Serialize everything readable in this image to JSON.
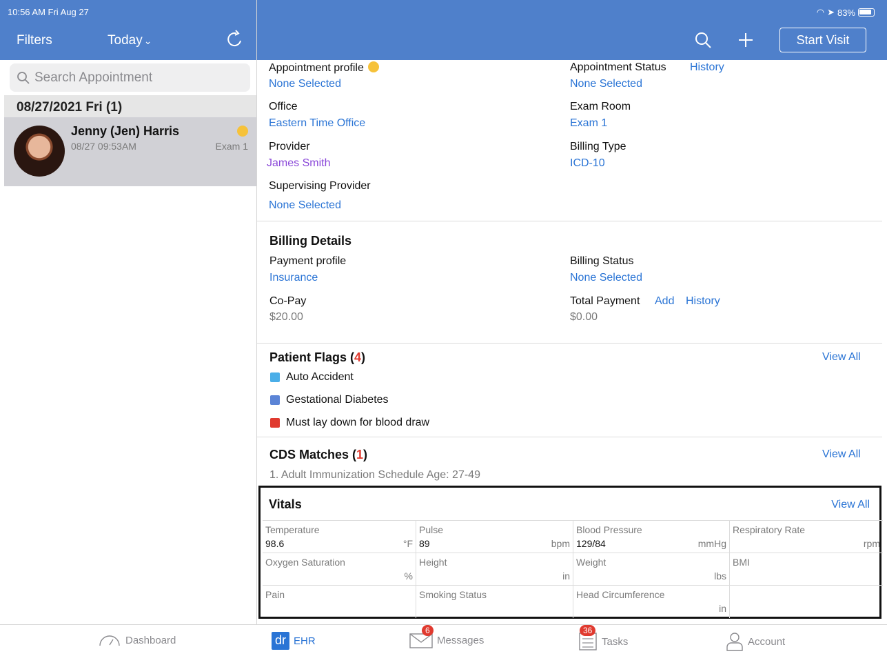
{
  "status_bar": {
    "time": "10:56 AM  Fri Aug 27",
    "battery": "83%"
  },
  "left_nav": {
    "filters": "Filters",
    "today": "Today",
    "today_chevron": "⌄"
  },
  "right_nav": {
    "start_visit": "Start Visit"
  },
  "search": {
    "placeholder": "Search Appointment"
  },
  "date_header": "08/27/2021 Fri (1)",
  "appointment": {
    "name": "Jenny (Jen) Harris",
    "time": "08/27 09:53AM",
    "room": "Exam 1"
  },
  "details": {
    "appointment_profile_label": "Appointment profile",
    "appointment_profile_value": "None Selected",
    "appointment_status_label": "Appointment Status",
    "appointment_status_history": "History",
    "appointment_status_value": "None Selected",
    "office_label": "Office",
    "office_value": "Eastern Time Office",
    "exam_room_label": "Exam Room",
    "exam_room_value": "Exam 1",
    "provider_label": "Provider",
    "provider_value": "James Smith",
    "billing_type_label": "Billing Type",
    "billing_type_value": "ICD-10",
    "supervising_label": "Supervising Provider",
    "supervising_value": "None Selected"
  },
  "billing": {
    "title": "Billing Details",
    "payment_profile_label": "Payment profile",
    "payment_profile_value": "Insurance",
    "billing_status_label": "Billing Status",
    "billing_status_value": "None Selected",
    "copay_label": "Co-Pay",
    "copay_value": "$20.00",
    "total_payment_label": "Total Payment",
    "total_payment_add": "Add",
    "total_payment_history": "History",
    "total_payment_value": "$0.00"
  },
  "patient_flags": {
    "title": "Patient Flags (",
    "count": "4",
    "close": ")",
    "view_all": "View All",
    "items": [
      {
        "label": "Auto Accident",
        "color": "#4aaee8"
      },
      {
        "label": "Gestational Diabetes",
        "color": "#5b84d6"
      },
      {
        "label": "Must lay down for blood draw",
        "color": "#e03a2f"
      }
    ]
  },
  "cds": {
    "title": "CDS Matches (",
    "count": "1",
    "close": ")",
    "view_all": "View All",
    "item": "1. Adult Immunization Schedule Age: 27-49"
  },
  "vitals": {
    "title": "Vitals",
    "view_all": "View All",
    "cells": [
      {
        "label": "Temperature",
        "value": "98.6",
        "unit": "°F"
      },
      {
        "label": "Pulse",
        "value": "89",
        "unit": "bpm"
      },
      {
        "label": "Blood Pressure",
        "value": "129/84",
        "unit": "mmHg"
      },
      {
        "label": "Respiratory Rate",
        "value": "",
        "unit": "rpm"
      },
      {
        "label": "Oxygen Saturation",
        "value": "",
        "unit": "%"
      },
      {
        "label": "Height",
        "value": "",
        "unit": "in"
      },
      {
        "label": "Weight",
        "value": "",
        "unit": "lbs"
      },
      {
        "label": "BMI",
        "value": "",
        "unit": ""
      },
      {
        "label": "Pain",
        "value": "",
        "unit": ""
      },
      {
        "label": "Smoking Status",
        "value": "",
        "unit": ""
      },
      {
        "label": "Head Circumference",
        "value": "",
        "unit": "in"
      },
      {
        "label": "",
        "value": "",
        "unit": ""
      }
    ]
  },
  "tabs": {
    "dashboard": "Dashboard",
    "ehr": "EHR",
    "ehr_logo": "dr",
    "messages": "Messages",
    "messages_badge": "6",
    "tasks": "Tasks",
    "tasks_badge": "36",
    "account": "Account"
  }
}
